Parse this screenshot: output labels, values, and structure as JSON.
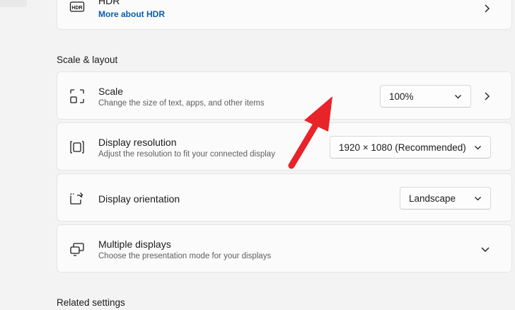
{
  "hdr": {
    "title": "HDR",
    "link": "More about HDR",
    "icon": "hdr-icon"
  },
  "scale_layout": {
    "heading": "Scale & layout",
    "scale": {
      "title": "Scale",
      "subtitle": "Change the size of text, apps, and other items",
      "value": "100%",
      "icon": "scale-icon"
    },
    "resolution": {
      "title": "Display resolution",
      "subtitle": "Adjust the resolution to fit your connected display",
      "value": "1920 × 1080 (Recommended)",
      "icon": "resolution-icon"
    },
    "orientation": {
      "title": "Display orientation",
      "value": "Landscape",
      "icon": "orientation-icon"
    },
    "multiple": {
      "title": "Multiple displays",
      "subtitle": "Choose the presentation mode for your displays",
      "icon": "multiple-displays-icon"
    }
  },
  "related": {
    "heading": "Related settings"
  },
  "colors": {
    "link": "#0b5cad",
    "annotation_arrow": "#e8232a"
  }
}
